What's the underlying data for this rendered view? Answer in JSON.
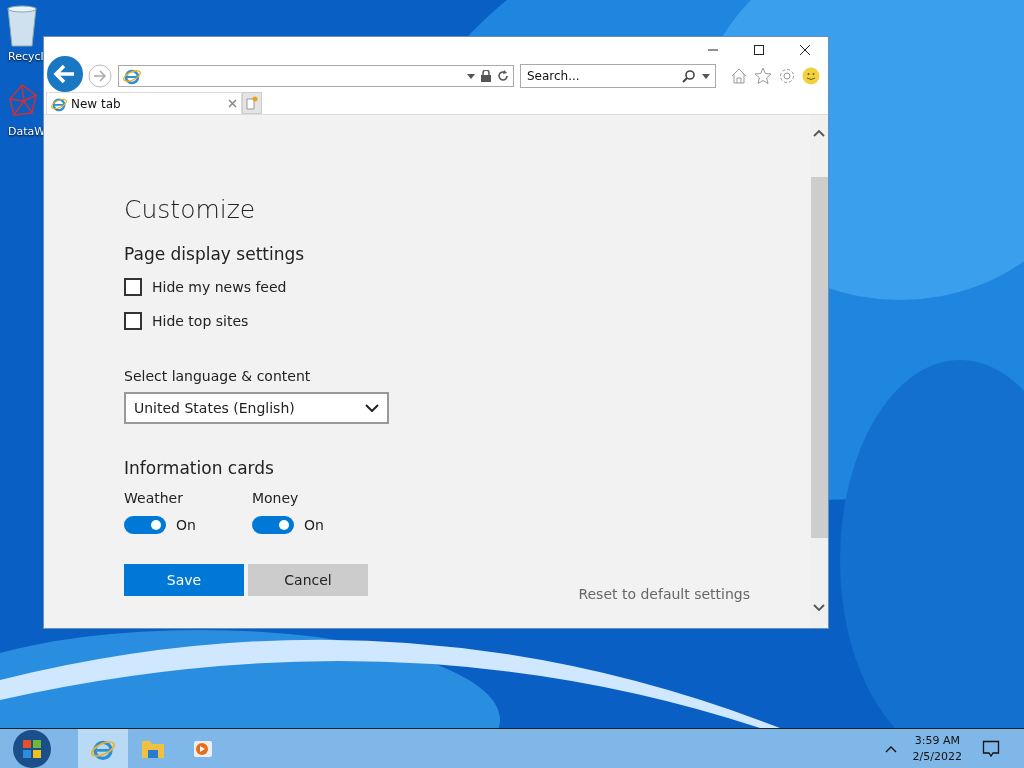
{
  "desktop": {
    "icons": [
      {
        "label": "Recycl",
        "kind": "bin"
      },
      {
        "label": "DataW",
        "kind": "network"
      }
    ]
  },
  "browser": {
    "search": {
      "placeholder": "Search..."
    },
    "tabs": [
      {
        "label": "New tab",
        "selected": true
      }
    ]
  },
  "page": {
    "title": "Customize",
    "section": "Page display settings",
    "checkboxes": [
      {
        "label": "Hide my news feed",
        "checked": false
      },
      {
        "label": "Hide top sites",
        "checked": false
      }
    ],
    "language": {
      "label": "Select language & content",
      "value": "United States (English)"
    },
    "cards": {
      "title": "Information cards",
      "toggles": [
        {
          "label": "Weather",
          "on": true,
          "state_text": "On"
        },
        {
          "label": "Money",
          "on": true,
          "state_text": "On"
        }
      ]
    },
    "buttons": [
      {
        "label": "Save",
        "kind": "primary"
      },
      {
        "label": "Cancel",
        "kind": "secondary"
      }
    ],
    "reset_link": "Reset to default settings"
  },
  "taskbar": {
    "apps": [
      {
        "kind": "ie",
        "selected": true
      },
      {
        "kind": "folder",
        "selected": false
      },
      {
        "kind": "media",
        "selected": false
      }
    ],
    "clock": {
      "time": "3:59 AM",
      "date": "2/5/2022"
    }
  }
}
